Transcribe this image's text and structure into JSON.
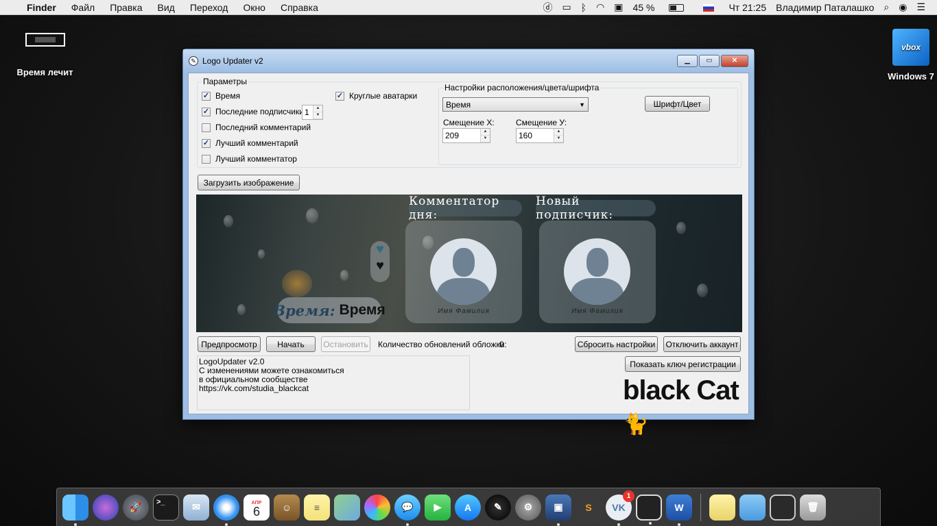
{
  "menubar": {
    "app": "Finder",
    "items": [
      "Файл",
      "Правка",
      "Вид",
      "Переход",
      "Окно",
      "Справка"
    ],
    "battery": "45 %",
    "clock": "Чт 21:25",
    "user": "Владимир Паталашко"
  },
  "desktop": {
    "left_icon_label": "Время лечит",
    "right_icon_label": "Windows 7",
    "right_icon_text": "vbox"
  },
  "window": {
    "title": "Logo Updater v2",
    "params_group": "Параметры",
    "checkboxes": [
      {
        "label": "Время",
        "checked": true
      },
      {
        "label": "Последние подписчики",
        "checked": true
      },
      {
        "label": "Последний комментарий",
        "checked": false
      },
      {
        "label": "Лучший комментарий",
        "checked": true
      },
      {
        "label": "Лучший комментатор",
        "checked": false
      }
    ],
    "round_avatars": {
      "label": "Круглые аватарки",
      "checked": true
    },
    "subscribers_count": "1",
    "settings_group": "Настройки расположения/цвета/шрифта",
    "element_select": "Время",
    "font_color_button": "Шрифт/Цвет",
    "offset_x_label": "Смещение X:",
    "offset_x_value": "209",
    "offset_y_label": "Смещение У:",
    "offset_y_value": "160",
    "load_image_button": "Загрузить изображение",
    "preview": {
      "commentator_title": "Комментатор дня:",
      "subscriber_title": "Новый подписчик:",
      "name_placeholder": "Имя Фамилия",
      "time_label": "Время:",
      "time_value": "Время"
    },
    "preview_button": "Предпросмотр",
    "start_button": "Начать",
    "stop_button": "Остановить",
    "updates_label": "Количество обновлений обложки:",
    "updates_count": "0",
    "reset_button": "Сбросить настройки",
    "disconnect_button": "Отключить аккаунт",
    "show_key_button": "Показать ключ регистрации",
    "log_lines": [
      "LogoUpdater v2.0",
      "С изменениями можете ознакомиться",
      "в официальном сообществе",
      "https://vk.com/studia_blackcat"
    ],
    "logo_text": "black Cat"
  },
  "dock": {
    "calendar_month": "АПР",
    "calendar_day": "6",
    "vk_badge": "1",
    "vk_label": "VK",
    "icons": [
      "finder-icon",
      "siri-icon",
      "launchpad-icon",
      "terminal-icon",
      "mail-icon",
      "safari-icon",
      "calendar-icon",
      "contacts-icon",
      "notes-icon",
      "maps-icon",
      "photos-icon",
      "messages-icon",
      "facetime-icon",
      "appstore-icon",
      "photobooth-icon",
      "preferences-icon",
      "virtualbox-icon",
      "sublime-icon",
      "vk-icon",
      "screenshot-icon",
      "word-icon"
    ],
    "colors": {
      "accent": "#2f7fe0"
    }
  }
}
